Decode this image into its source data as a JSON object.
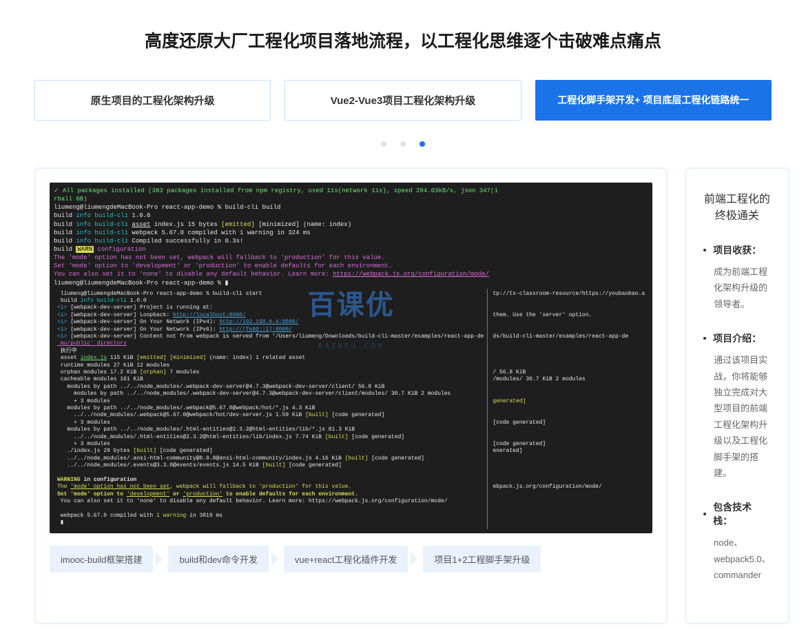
{
  "title": "高度还原大厂工程化项目落地流程，以工程化思维逐个击破难点痛点",
  "tabs": [
    {
      "label": "原生项目的工程化架构升级",
      "active": false
    },
    {
      "label": "Vue2-Vue3项目工程化架构升级",
      "active": false
    },
    {
      "label": "工程化脚手架开发+ 项目底层工程化链路统一",
      "active": true
    }
  ],
  "dots": {
    "count": 3,
    "active_index": 2
  },
  "watermark": {
    "main": "百课优",
    "sub": "BAIKEU.COM"
  },
  "terminal_top": [
    {
      "cls": "t-green",
      "text": "✓ All packages installed (383 packages installed from npm registry, used 11s(network 11s), speed 204.03kB/s, json 347(1"
    },
    {
      "cls": "t-green",
      "text": "rball 0B)"
    },
    {
      "cls": "t-white",
      "text": "liumeng@liumengdeMacBook-Pro react-app-demo % build-cli build"
    },
    {
      "mixed": [
        [
          "t-white",
          "build "
        ],
        [
          "t-cyan",
          "info"
        ],
        [
          "t-white",
          " "
        ],
        [
          "t-teal",
          "build-cli"
        ],
        [
          "t-white",
          " 1.0.0"
        ]
      ]
    },
    {
      "mixed": [
        [
          "t-white",
          "build "
        ],
        [
          "t-cyan",
          "info"
        ],
        [
          "t-white",
          " "
        ],
        [
          "t-teal",
          "build-cli"
        ],
        [
          "t-white",
          " "
        ],
        [
          "t-white t-ul",
          "asset"
        ],
        [
          "t-white",
          " index.js 15 bytes "
        ],
        [
          "t-yellow",
          "[emitted]"
        ],
        [
          "t-white",
          " [minimized] (name: index)"
        ]
      ]
    },
    {
      "mixed": [
        [
          "t-white",
          "build "
        ],
        [
          "t-cyan",
          "info"
        ],
        [
          "t-white",
          " "
        ],
        [
          "t-teal",
          "build-cli"
        ],
        [
          "t-white",
          " webpack 5.67.0 compiled with 1 warning in 324 ms"
        ]
      ]
    },
    {
      "mixed": [
        [
          "t-white",
          "build "
        ],
        [
          "t-cyan",
          "info"
        ],
        [
          "t-white",
          " "
        ],
        [
          "t-teal",
          "build-cli"
        ],
        [
          "t-white",
          " Compiled successfully in 0.3s!"
        ]
      ]
    },
    {
      "mixed": [
        [
          "t-white",
          "build "
        ],
        [
          "t-yellow-bg",
          "WARN"
        ],
        [
          "t-white",
          " "
        ],
        [
          "t-magenta",
          "configuration"
        ]
      ]
    },
    {
      "cls": "t-magenta",
      "text": "The 'mode' option has not been set, webpack will fallback to 'production' for this value."
    },
    {
      "cls": "t-magenta",
      "text": "Set 'mode' option to 'development' or 'production' to enable defaults for each environment."
    },
    {
      "mixed": [
        [
          "t-magenta",
          "You can also set it to 'none' to disable any default behavior. Learn more: "
        ],
        [
          "t-magenta t-ul",
          "https://webpack.js.org/configuration/mode/"
        ]
      ]
    },
    {
      "cls": "t-white",
      "text": "liumeng@liumengdeMacBook-Pro react-app-demo % ▮"
    }
  ],
  "terminal_left": [
    {
      "cls": "t-white",
      "text": " liumeng@liumengdeMacBook-Pro react-app-demo % build-cli start"
    },
    {
      "mixed": [
        [
          "t-white",
          " build "
        ],
        [
          "t-cyan",
          "info"
        ],
        [
          "t-white",
          " "
        ],
        [
          "t-teal",
          "build-cli"
        ],
        [
          "t-white",
          " 1.0.0"
        ]
      ]
    },
    {
      "mixed": [
        [
          "t-blue",
          "<i>"
        ],
        [
          "t-white",
          " [webpack-dev-server] Project is running at:"
        ]
      ]
    },
    {
      "mixed": [
        [
          "t-blue",
          "<i>"
        ],
        [
          "t-white",
          " [webpack-dev-server] Loopback: "
        ],
        [
          "t-blue t-ul",
          "http://localhost:8000/"
        ]
      ]
    },
    {
      "mixed": [
        [
          "t-blue",
          "<i>"
        ],
        [
          "t-white",
          " [webpack-dev-server] On Your Network (IPv4): "
        ],
        [
          "t-blue t-ul",
          "http://192.168.0.4:8000/"
        ]
      ]
    },
    {
      "mixed": [
        [
          "t-blue",
          "<i>"
        ],
        [
          "t-white",
          " [webpack-dev-server] On Your Network (IPv6): "
        ],
        [
          "t-blue t-ul",
          "http://[fe80::1]:8000/"
        ]
      ]
    },
    {
      "mixed": [
        [
          "t-blue",
          "<i>"
        ],
        [
          "t-white",
          " [webpack-dev-server] Content not from webpack is served from '/Users/liumeng/Downloads/build-cli-master/examples/react-app-de"
        ]
      ]
    },
    {
      "cls": "t-magenta t-ul",
      "text": " mo/public' directory"
    },
    {
      "cls": "t-white",
      "text": " 执行中"
    },
    {
      "mixed": [
        [
          "t-white",
          " asset "
        ],
        [
          "t-green t-ul",
          "index.js"
        ],
        [
          "t-white",
          " 115 KiB "
        ],
        [
          "t-yellow",
          "[emitted]"
        ],
        [
          "t-white",
          " "
        ],
        [
          "t-yellow",
          "[minimized]"
        ],
        [
          "t-white",
          " (name: index) 1 related asset"
        ]
      ]
    },
    {
      "cls": "t-white",
      "text": " runtime modules 27 KiB 12 modules"
    },
    {
      "mixed": [
        [
          "t-white",
          " orphan modules 17.2 KiB "
        ],
        [
          "t-yellow",
          "[orphan]"
        ],
        [
          "t-white",
          " 7 modules"
        ]
      ]
    },
    {
      "cls": "t-white",
      "text": " cacheable modules 161 KiB"
    },
    {
      "cls": "t-white",
      "text": "   modules by path ../../node_modules/.webpack-dev-server@4.7.3@webpack-dev-server/client/ 56.8 KiB"
    },
    {
      "cls": "t-white",
      "text": "     modules by path ../../node_modules/.webpack-dev-server@4.7.3@webpack-dev-server/client/modules/ 30.7 KiB 2 modules"
    },
    {
      "cls": "t-white",
      "text": "     + 3 modules"
    },
    {
      "cls": "t-white",
      "text": "   modules by path ../../node_modules/.webpack@5.67.0@webpack/hot/*.js 4.3 KiB"
    },
    {
      "mixed": [
        [
          "t-white",
          "     ../../node_modules/.webpack@5.67.0@webpack/hot/dev-server.js 1.59 KiB "
        ],
        [
          "t-yellow",
          "[built]"
        ],
        [
          "t-white",
          " [code generated]"
        ]
      ]
    },
    {
      "cls": "t-white",
      "text": "     + 3 modules"
    },
    {
      "cls": "t-white",
      "text": "   modules by path ../../node_modules/.html-entities@2.3.2@html-entities/lib/*.js 81.3 KiB"
    },
    {
      "mixed": [
        [
          "t-white",
          "     ../../node_modules/.html-entities@2.3.2@html-entities/lib/index.js 7.74 KiB "
        ],
        [
          "t-yellow",
          "[built]"
        ],
        [
          "t-white",
          " [code generated]"
        ]
      ]
    },
    {
      "cls": "t-white",
      "text": "     + 3 modules"
    },
    {
      "mixed": [
        [
          "t-white",
          "   ./index.js 29 bytes "
        ],
        [
          "t-yellow",
          "[built]"
        ],
        [
          "t-white",
          " [code generated]"
        ]
      ]
    },
    {
      "mixed": [
        [
          "t-white",
          "   ../../node_modules/.ansi-html-community@0.0.8@ansi-html-community/index.js 4.16 KiB "
        ],
        [
          "t-yellow",
          "[built]"
        ],
        [
          "t-white",
          " [code generated]"
        ]
      ]
    },
    {
      "mixed": [
        [
          "t-white",
          "   ../../node_modules/.events@3.3.0@events/events.js 14.5 KiB "
        ],
        [
          "t-yellow",
          "[built]"
        ],
        [
          "t-white",
          " [code generated]"
        ]
      ]
    },
    {
      "cls": "",
      "text": " "
    },
    {
      "mixed": [
        [
          "t-yellow t-bold",
          "WARNING"
        ],
        [
          "t-white t-bold",
          " in configuration"
        ]
      ]
    },
    {
      "mixed": [
        [
          "t-yellow",
          "The "
        ],
        [
          "t-yellow t-ul",
          "'mode' option has not been set"
        ],
        [
          "t-yellow",
          ", webpack will fallback to 'production' for this value."
        ]
      ]
    },
    {
      "mixed": [
        [
          "t-yellow t-bold",
          "Set 'mode' option to "
        ],
        [
          "t-yellow t-ul",
          "'development'"
        ],
        [
          "t-yellow t-bold",
          " or "
        ],
        [
          "t-yellow t-ul",
          "'production'"
        ],
        [
          "t-yellow t-bold",
          " to enable defaults for each environment."
        ]
      ]
    },
    {
      "cls": "t-white",
      "text": " You can also set it to 'none' to disable any default behavior. Learn more: https://webpack.js.org/configuration/mode/"
    },
    {
      "cls": "",
      "text": " "
    },
    {
      "mixed": [
        [
          "t-white",
          " webpack 5.67.0 compiled with "
        ],
        [
          "t-yellow",
          "1 warning"
        ],
        [
          "t-white",
          " in 3819 ms"
        ]
      ]
    },
    {
      "cls": "t-white",
      "text": " ▮"
    }
  ],
  "terminal_right": [
    {
      "cls": "t-white",
      "text": "tp://tx-classroom-resource/https://youbaobao.a"
    },
    {
      "cls": "t-white",
      "text": " "
    },
    {
      "cls": "t-white",
      "text": " "
    },
    {
      "cls": "t-white",
      "text": "them. Use the 'server' option."
    },
    {
      "cls": "t-white",
      "text": " "
    },
    {
      "cls": "t-white",
      "text": " "
    },
    {
      "cls": "t-white",
      "text": "ds/build-cli-master/examples/react-app-de"
    },
    {
      "cls": "t-white",
      "text": " "
    },
    {
      "cls": "t-white",
      "text": " "
    },
    {
      "cls": "t-white",
      "text": " "
    },
    {
      "cls": "t-white",
      "text": " "
    },
    {
      "cls": "t-white",
      "text": "/ 56.8 KiB"
    },
    {
      "cls": "t-white",
      "text": "/modules/ 30.7 KiB 2 modules"
    },
    {
      "cls": "t-white",
      "text": " "
    },
    {
      "cls": "t-white",
      "text": " "
    },
    {
      "cls": "t-yellow",
      "text": "generated]"
    },
    {
      "cls": "t-white",
      "text": " "
    },
    {
      "cls": "t-white",
      "text": " "
    },
    {
      "cls": "t-white",
      "text": "[code generated]"
    },
    {
      "cls": "t-white",
      "text": " "
    },
    {
      "cls": "t-white",
      "text": " "
    },
    {
      "cls": "t-white",
      "text": "[code generated]"
    },
    {
      "cls": "t-white",
      "text": "enerated]"
    },
    {
      "cls": "t-white",
      "text": " "
    },
    {
      "cls": "t-white",
      "text": " "
    },
    {
      "cls": "t-white",
      "text": " "
    },
    {
      "cls": "t-white",
      "text": " "
    },
    {
      "cls": "t-white",
      "text": "ebpack.js.org/configuration/mode/"
    }
  ],
  "chips": [
    "imooc-build框架搭建",
    "build和dev命令开发",
    "vue+react工程化插件开发",
    "项目1+2工程脚手架升级"
  ],
  "right": {
    "title": "前端工程化的终极通关",
    "sections": [
      {
        "label": "项目收获：",
        "text": "成为前端工程化架构升级的领导者。"
      },
      {
        "label": "项目介绍：",
        "text": "通过该项目实战，你将能够独立完成对大型项目的前端工程化架构升级以及工程化脚手架的搭建。"
      },
      {
        "label": "包含技术栈：",
        "text": "node、webpack5.0、commander"
      }
    ]
  }
}
